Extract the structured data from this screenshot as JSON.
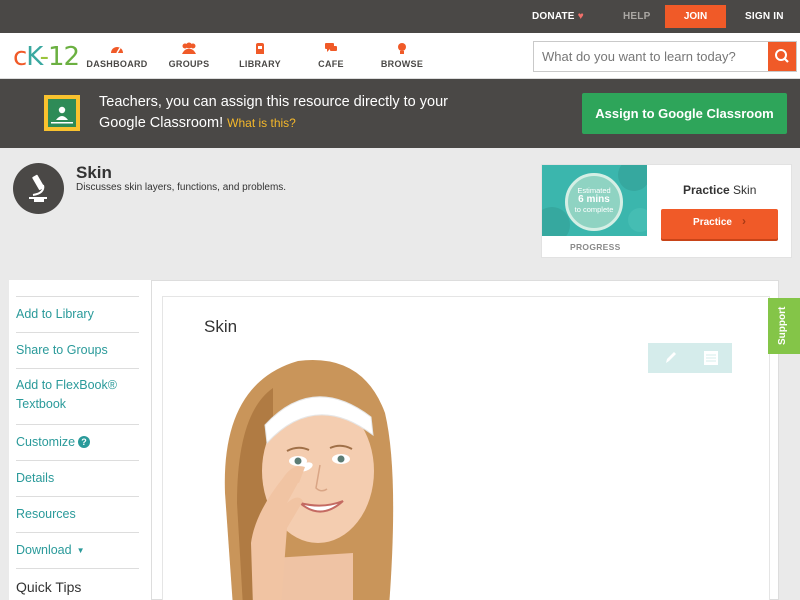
{
  "topbar": {
    "donate_label": "DONATE",
    "help_label": "HELP",
    "join_label": "JOIN",
    "signin_label": "SIGN IN"
  },
  "logo": {
    "c": "c",
    "k": "K",
    "dash": "-",
    "n": "12"
  },
  "nav": [
    {
      "label": "DASHBOARD",
      "icon": "dashboard-icon"
    },
    {
      "label": "GROUPS",
      "icon": "groups-icon"
    },
    {
      "label": "LIBRARY",
      "icon": "library-icon"
    },
    {
      "label": "CAFE",
      "icon": "cafe-icon"
    },
    {
      "label": "BROWSE",
      "icon": "browse-icon"
    }
  ],
  "search": {
    "placeholder": "What do you want to learn today?",
    "value": ""
  },
  "classroom_banner": {
    "text": "Teachers, you can assign this resource directly to your Google Classroom!",
    "link": "What is this?",
    "button": "Assign to Google Classroom"
  },
  "concept": {
    "title": "Skin",
    "description": "Discusses skin layers, functions, and problems."
  },
  "practice": {
    "estimate_line1": "Estimated",
    "estimate_line2": "6 mins",
    "estimate_line3": "to complete",
    "progress_label": "PROGRESS",
    "title_bold": "Practice",
    "title_rest": " Skin",
    "button": "Practice"
  },
  "sidebar": {
    "items": [
      {
        "label": "Add to Library"
      },
      {
        "label": "Share to Groups"
      },
      {
        "label": "Add to FlexBook® Textbook"
      },
      {
        "label": "Customize"
      },
      {
        "label": "Details"
      },
      {
        "label": "Resources"
      },
      {
        "label": "Download"
      }
    ],
    "quick_tips": "Quick Tips"
  },
  "content": {
    "title": "Skin"
  },
  "support_label": "Support",
  "colors": {
    "brand_orange": "#f05a28",
    "banner_dark": "#4a4846",
    "teal_link": "#2a9a9a",
    "classroom_green": "#2ea55a",
    "support_green": "#84c548"
  }
}
